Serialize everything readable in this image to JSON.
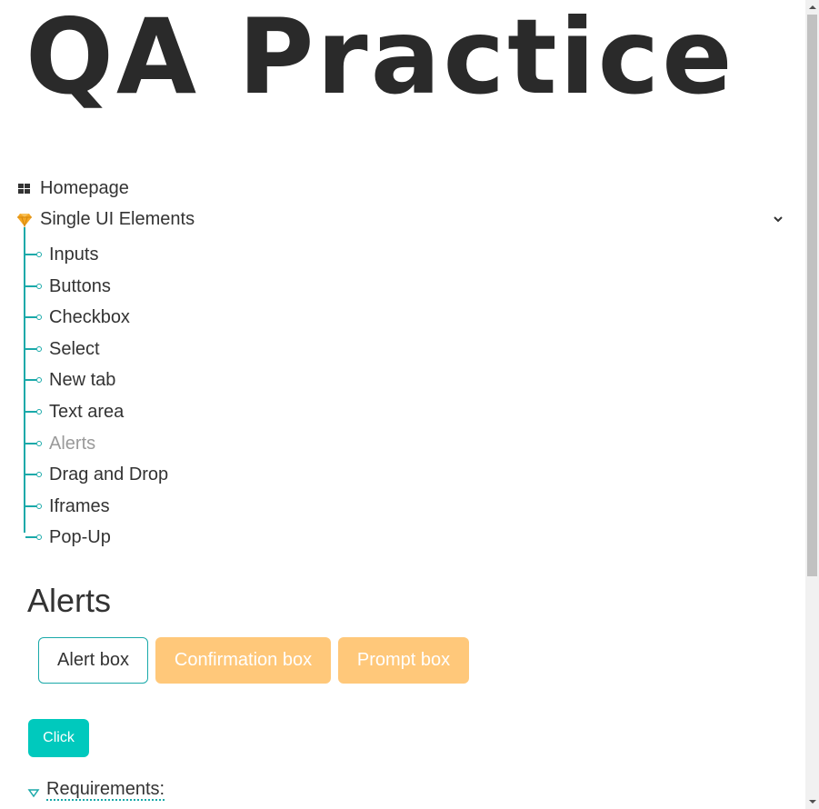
{
  "logo": {
    "text": "QA Practice"
  },
  "menu": {
    "homepage": {
      "label": "Homepage",
      "icon": "grid-icon"
    },
    "single_ui": {
      "label": "Single UI Elements",
      "icon": "gem-icon",
      "expanded": true
    },
    "sub_items": [
      {
        "label": "Inputs",
        "active": false
      },
      {
        "label": "Buttons",
        "active": false
      },
      {
        "label": "Checkbox",
        "active": false
      },
      {
        "label": "Select",
        "active": false
      },
      {
        "label": "New tab",
        "active": false
      },
      {
        "label": "Text area",
        "active": false
      },
      {
        "label": "Alerts",
        "active": true
      },
      {
        "label": "Drag and Drop",
        "active": false
      },
      {
        "label": "Iframes",
        "active": false
      },
      {
        "label": "Pop-Up",
        "active": false
      }
    ]
  },
  "page": {
    "title": "Alerts",
    "tabs": [
      {
        "label": "Alert box",
        "selected": true
      },
      {
        "label": "Confirmation box",
        "selected": false
      },
      {
        "label": "Prompt box",
        "selected": false
      }
    ],
    "click_label": "Click",
    "requirements_label": "Requirements:"
  },
  "colors": {
    "accent_teal": "#1aa9a9",
    "click_button": "#00c9bd",
    "inactive_tab": "#ffc87a",
    "gem_icon": "#f5a623"
  }
}
